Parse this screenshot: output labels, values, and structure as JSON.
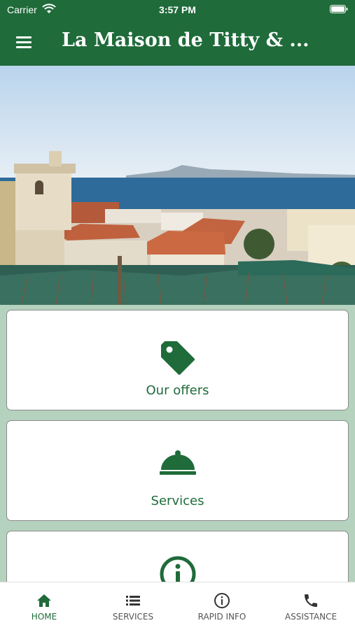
{
  "status_bar": {
    "carrier": "Carrier",
    "time": "3:57 PM"
  },
  "app_bar": {
    "title": "La Maison de Titty & ...",
    "menu_icon": "hamburger-menu-icon"
  },
  "hero": {
    "description_icon": "sea-landscape-image"
  },
  "cards": [
    {
      "label": "Our offers",
      "icon": "tag-icon"
    },
    {
      "label": "Services",
      "icon": "service-bell-icon"
    },
    {
      "label": "",
      "icon": "info-circle-icon"
    }
  ],
  "tabs": [
    {
      "label": "HOME",
      "icon": "home-icon",
      "active": true
    },
    {
      "label": "SERVICES",
      "icon": "list-icon",
      "active": false
    },
    {
      "label": "RAPID INFO",
      "icon": "info-icon",
      "active": false
    },
    {
      "label": "ASSISTANCE",
      "icon": "phone-icon",
      "active": false
    }
  ],
  "colors": {
    "primary": "#1f6b3a",
    "background": "#b5d2be",
    "inactive_tab": "#555555"
  }
}
